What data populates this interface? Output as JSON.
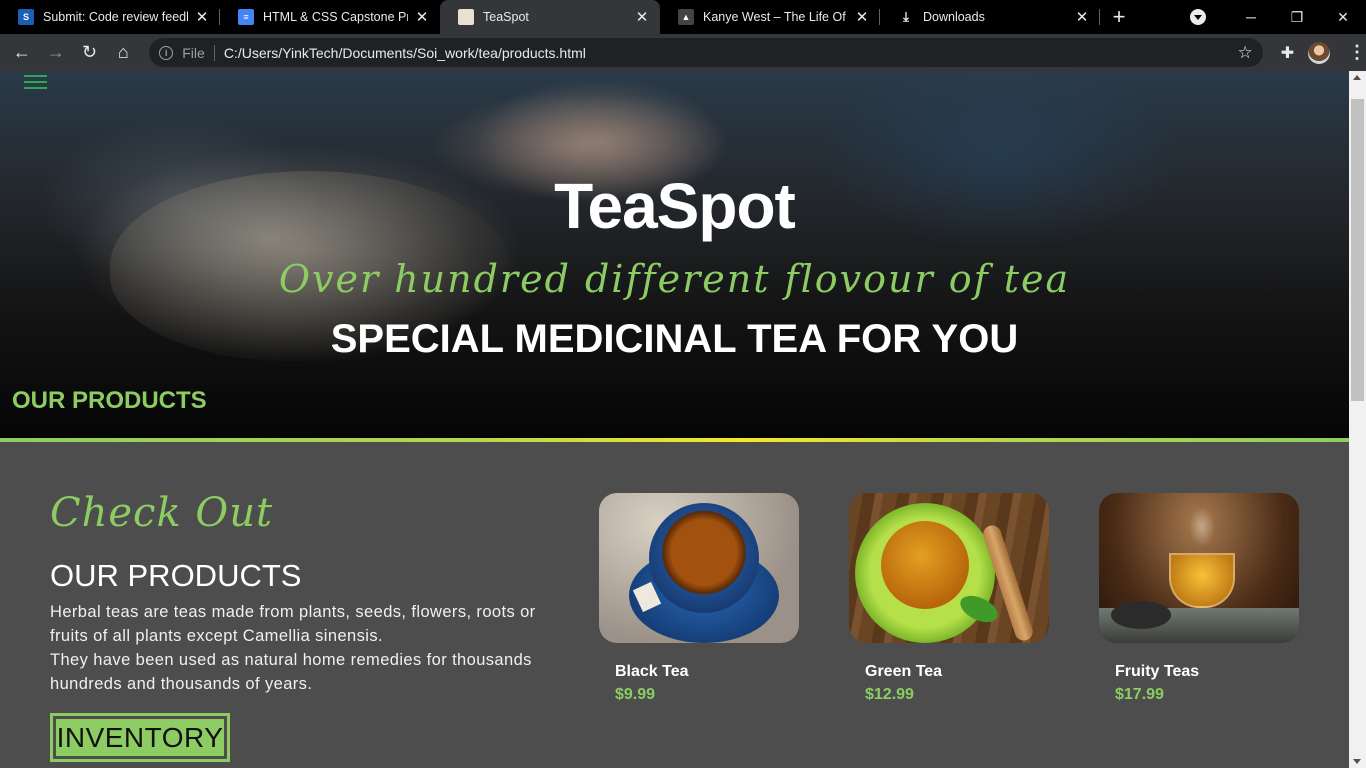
{
  "browser": {
    "tabs": [
      {
        "title": "Submit: Code review feedback",
        "icon": "sick-favicon-icon",
        "color": "#1a5fb4"
      },
      {
        "title": "HTML & CSS Capstone Project",
        "icon": "google-docs-icon",
        "color": "#4285f4"
      },
      {
        "title": "TeaSpot",
        "icon": "page-favicon-icon",
        "color": "#e8e0d0"
      },
      {
        "title": "Kanye West – The Life Of Pablo",
        "icon": "flame-favicon-icon",
        "color": "#444444"
      },
      {
        "title": "Downloads",
        "icon": "download-icon",
        "color": "#000000"
      }
    ],
    "active_tab": 2,
    "scheme_label": "File",
    "url": "C:/Users/YinkTech/Documents/Soi_work/tea/products.html"
  },
  "hero": {
    "title": "TeaSpot",
    "tagline": "Over hundred different flovour of tea",
    "subtitle": "SPECIAL MEDICINAL TEA FOR YOU",
    "section_label": "OUR PRODUCTS"
  },
  "products_section": {
    "script_heading": "Check Out",
    "heading": "OUR PRODUCTS",
    "description_line1": "Herbal teas are teas made from plants, seeds, flowers, roots or fruits of all plants except Camellia sinensis.",
    "description_line2": "They have been used as natural home remedies for thousands hundreds and thousands of years.",
    "button_label": "INVENTORY"
  },
  "products": [
    {
      "name": "Black Tea",
      "price": "$9.99"
    },
    {
      "name": "Green Tea",
      "price": "$12.99"
    },
    {
      "name": "Fruity Teas",
      "price": "$17.99"
    }
  ],
  "colors": {
    "accent": "#8ccc63",
    "menu": "#2ea84e",
    "section_bg": "#4d4d4d"
  }
}
